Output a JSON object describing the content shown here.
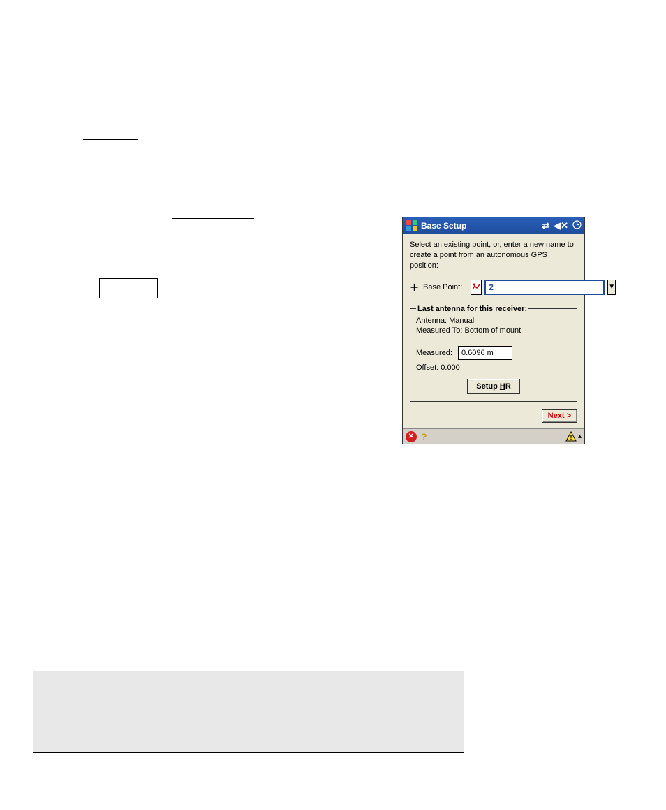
{
  "titlebar": {
    "title": "Base Setup"
  },
  "instruction": "Select an existing point, or, enter a new name to create a point from an autonomous GPS position:",
  "basePoint": {
    "label": "Base Point:",
    "value": "2"
  },
  "antennaBox": {
    "legend": "Last antenna for this receiver:",
    "antennaLabel": "Antenna:",
    "antennaValue": "Manual",
    "measuredToLabel": "Measured To:",
    "measuredToValue": "Bottom of mount",
    "measuredLabel": "Measured:",
    "measuredValue": "0.6096 m",
    "offsetLabel": "Offset:",
    "offsetValue": "0.000",
    "setupHrLabel": "Setup HR"
  },
  "nextLabel": "Next >",
  "icons": {
    "connectivity": "connectivity-icon",
    "speaker": "speaker-icon",
    "clock": "clock-icon",
    "close": "close-icon",
    "help": "help-icon",
    "warning": "warning-icon",
    "up": "up-triangle-icon",
    "map": "map-picker-icon",
    "dropdown": "dropdown-icon",
    "plus": "plus-icon"
  }
}
